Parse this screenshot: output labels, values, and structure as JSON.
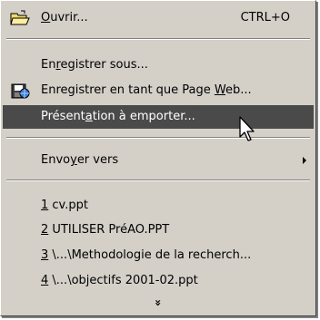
{
  "menu": {
    "open": {
      "label_u": "O",
      "label_rest": "uvrir...",
      "shortcut": "CTRL+O",
      "icon": "open-folder-icon"
    },
    "save_as": {
      "pre": "En",
      "u": "r",
      "post": "egistrer sous..."
    },
    "save_web": {
      "pre": "Enregistrer en tant que Page ",
      "u": "W",
      "post": "eb...",
      "icon": "save-web-page-icon"
    },
    "presentation": {
      "pre": "Présent",
      "u": "a",
      "post": "tion à emporter...",
      "highlighted": true
    },
    "send_to": {
      "pre": "Envo",
      "u": "y",
      "post": "er vers"
    },
    "recent": [
      {
        "u": "1",
        "post": " cv.ppt"
      },
      {
        "u": "2",
        "post": " UTILISER PréAO.PPT"
      },
      {
        "u": "3",
        "post": " \\...\\Methodologie de la recherch..."
      },
      {
        "u": "4",
        "post": " \\...\\objectifs 2001-02.ppt"
      }
    ],
    "expand_glyph": "»"
  },
  "colors": {
    "menu_bg": "#d4d0c8",
    "highlight_bg": "#4a4a4a",
    "highlight_text": "#ffffff"
  }
}
